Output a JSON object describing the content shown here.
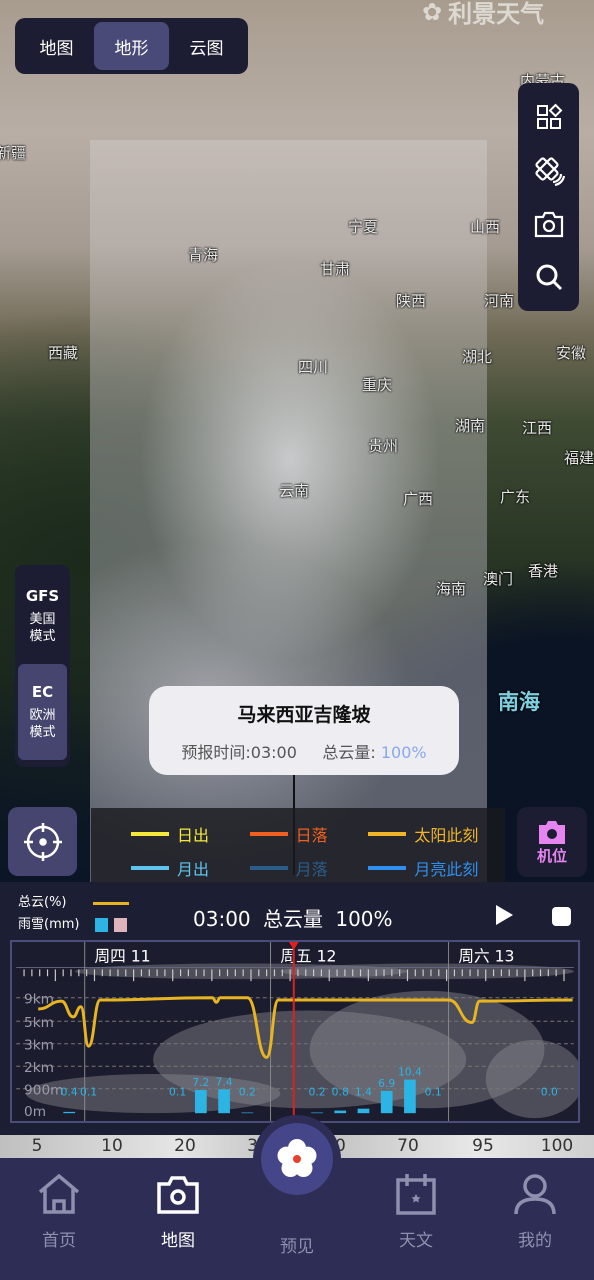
{
  "watermark": "利景天气",
  "map_type": {
    "options": [
      "地图",
      "地形",
      "云图"
    ],
    "selected": "地形"
  },
  "toolbar": {
    "icons": [
      "layers-icon",
      "satellite-icon",
      "camera-icon",
      "search-icon"
    ]
  },
  "map": {
    "labels": [
      "新疆",
      "青海",
      "西藏",
      "宁夏",
      "甘肃",
      "山西",
      "陕西",
      "河南",
      "四川",
      "湖北",
      "安徽",
      "重庆",
      "湖南",
      "江西",
      "贵州",
      "福建",
      "云南",
      "广西",
      "广东",
      "海南",
      "澳门",
      "香港",
      "内蒙古"
    ],
    "sea_label": "南海"
  },
  "models": [
    {
      "code": "GFS",
      "name": "美国模式"
    },
    {
      "code": "EC",
      "name": "欧洲模式",
      "selected": true
    }
  ],
  "popup": {
    "location": "马来西亚吉隆坡",
    "time_label": "预报时间:03:00",
    "cloud_label": "总云量: ",
    "cloud_value": "100%"
  },
  "legend": [
    {
      "label": "日出",
      "color": "#f5e83a"
    },
    {
      "label": "日落",
      "color": "#f0601e"
    },
    {
      "label": "太阳此刻",
      "color": "#f0b429"
    },
    {
      "label": "月出",
      "color": "#5ec4ee"
    },
    {
      "label": "月落",
      "color": "#2a5c8a"
    },
    {
      "label": "月亮此刻",
      "color": "#2f8ff0"
    }
  ],
  "camera_button": "机位",
  "panel": {
    "legend_cloud": "总云(%)",
    "legend_rain": "雨雪(mm)",
    "time": "03:00",
    "metric": "总云量",
    "value": "100%",
    "rain_colors": [
      "#2bb4e4",
      "#e0b4bc"
    ]
  },
  "chart_data": {
    "type": "line+bar",
    "days": [
      "周四 11",
      "周五 12",
      "周六 13"
    ],
    "ylabels": [
      "9km",
      "5km",
      "3km",
      "2km",
      "900m",
      "0m"
    ],
    "current_time": "周五 03:00",
    "cloud_series": {
      "color": "#e8b420",
      "points": [
        [
          "周三 18:00",
          90
        ],
        [
          "周三 21:00",
          97
        ],
        [
          "周三 22:30",
          83
        ],
        [
          "周三 23:30",
          92
        ],
        [
          "周四 00:30",
          57
        ],
        [
          "周四 02:00",
          98
        ],
        [
          "周四 16:30",
          100
        ],
        [
          "周四 17:00",
          96
        ],
        [
          "周四 17:30",
          100
        ],
        [
          "周四 21:00",
          100
        ],
        [
          "周四 23:30",
          47
        ],
        [
          "周五 01:00",
          98
        ],
        [
          "周五 23:00",
          98
        ],
        [
          "周六 02:00",
          78
        ],
        [
          "周六 03:00",
          97
        ],
        [
          "周六 15:00",
          98
        ]
      ]
    },
    "rain": [
      [
        "周三 22:00",
        0.4
      ],
      [
        "周四 00:30",
        0.1
      ],
      [
        "周四 12:00",
        0.1
      ],
      [
        "周四 15:00",
        7.2
      ],
      [
        "周四 18:00",
        7.4
      ],
      [
        "周四 21:00",
        0.2
      ],
      [
        "周五 06:00",
        0.2
      ],
      [
        "周五 09:00",
        0.8
      ],
      [
        "周五 12:00",
        1.4
      ],
      [
        "周五 15:00",
        6.9
      ],
      [
        "周五 18:00",
        10.4
      ],
      [
        "周五 21:00",
        0.1
      ],
      [
        "周六 12:00",
        0.0
      ]
    ]
  },
  "scale": [
    "5",
    "10",
    "20",
    "30",
    "50",
    "70",
    "95",
    "100"
  ],
  "nav": [
    {
      "label": "首页"
    },
    {
      "label": "地图",
      "active": true
    },
    {
      "label": "预见"
    },
    {
      "label": "天文"
    },
    {
      "label": "我的"
    }
  ]
}
